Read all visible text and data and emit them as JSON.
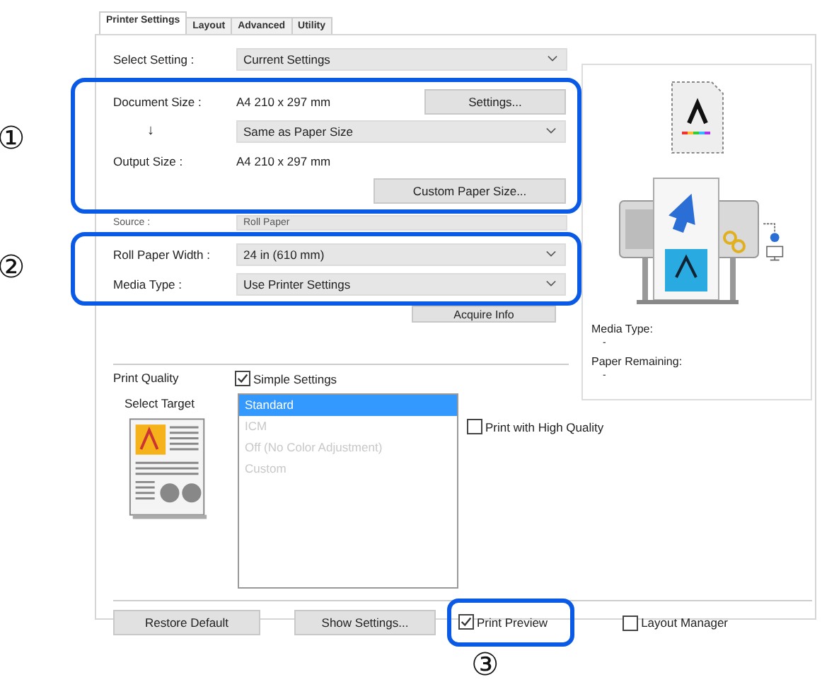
{
  "tabs": [
    {
      "label": "Printer Settings",
      "selected": true
    },
    {
      "label": "Layout",
      "selected": false
    },
    {
      "label": "Advanced",
      "selected": false
    },
    {
      "label": "Utility",
      "selected": false
    }
  ],
  "select_setting": {
    "label": "Select Setting :",
    "value": "Current Settings"
  },
  "paper_section": {
    "callout": "①",
    "document_size": {
      "label": "Document Size :",
      "value": "A4 210 x 297 mm",
      "button": "Settings..."
    },
    "arrow": "↓",
    "output_dropdown": "Same as Paper Size",
    "output_size": {
      "label": "Output Size :",
      "value": "A4 210 x 297 mm"
    },
    "button": "Custom Paper Size..."
  },
  "source": {
    "label": "Source :",
    "value": "Roll Paper"
  },
  "media_section": {
    "callout": "②",
    "roll_paper_width": {
      "label": "Roll Paper Width :",
      "value": "24 in (610 mm)"
    },
    "media_type": {
      "label": "Media Type :",
      "value": "Use Printer Settings"
    }
  },
  "acquire_button": "Acquire Info",
  "print_quality": {
    "label": "Print Quality",
    "simple_settings": {
      "label": "Simple Settings",
      "checked": true
    },
    "select_target_label": "Select Target",
    "targets": [
      {
        "label": "Standard",
        "selected": true,
        "disabled": false
      },
      {
        "label": "ICM",
        "selected": false,
        "disabled": true
      },
      {
        "label": "Off (No Color Adjustment)",
        "selected": false,
        "disabled": true
      },
      {
        "label": "Custom",
        "selected": false,
        "disabled": true
      }
    ],
    "high_quality": {
      "label": "Print with High Quality",
      "checked": false
    }
  },
  "status_panel": {
    "media_type_label": "Media Type:",
    "media_type_value": "-",
    "paper_remaining_label": "Paper Remaining:",
    "paper_remaining_value": "-"
  },
  "footer": {
    "buttons": [
      "Restore Default",
      "Show Settings..."
    ],
    "print_preview": {
      "label": "Print Preview",
      "checked": true,
      "callout": "③"
    },
    "layout_manager": {
      "label": "Layout Manager",
      "checked": false
    }
  }
}
